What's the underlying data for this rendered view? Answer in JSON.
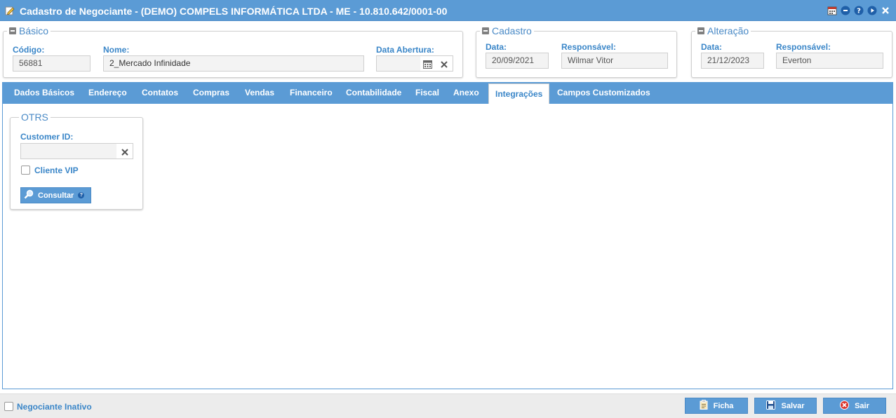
{
  "window": {
    "title": "Cadastro de Negociante - (DEMO) COMPELS INFORMÁTICA LTDA - ME - 10.810.642/0001-00",
    "icons": [
      "calendar-icon",
      "minimize-icon",
      "help-icon",
      "play-icon",
      "close-icon"
    ]
  },
  "basico": {
    "legend": "Básico",
    "codigo_label": "Código:",
    "codigo_value": "56881",
    "nome_label": "Nome:",
    "nome_value": "2_Mercado Infinidade",
    "data_abertura_label": "Data Abertura:",
    "data_abertura_value": ""
  },
  "cadastro": {
    "legend": "Cadastro",
    "data_label": "Data:",
    "data_value": "20/09/2021",
    "responsavel_label": "Responsável:",
    "responsavel_value": "Wilmar Vitor"
  },
  "alteracao": {
    "legend": "Alteração",
    "data_label": "Data:",
    "data_value": "21/12/2023",
    "responsavel_label": "Responsável:",
    "responsavel_value": "Everton"
  },
  "tabs": [
    {
      "label": "Dados Básicos"
    },
    {
      "label": "Endereço"
    },
    {
      "label": "Contatos"
    },
    {
      "label": "Compras"
    },
    {
      "label": "Vendas"
    },
    {
      "label": "Financeiro"
    },
    {
      "label": "Contabilidade"
    },
    {
      "label": "Fiscal"
    },
    {
      "label": "Anexo"
    },
    {
      "label": "Integrações"
    },
    {
      "label": "Campos Customizados"
    }
  ],
  "active_tab": "Integrações",
  "otrs": {
    "legend": "OTRS",
    "customer_id_label": "Customer ID:",
    "customer_id_value": "",
    "cliente_vip_label": "Cliente VIP",
    "consultar_label": "Consultar",
    "help_glyph": "?"
  },
  "footer": {
    "inativo_label": "Negociante Inativo",
    "ficha_label": "Ficha",
    "salvar_label": "Salvar",
    "sair_label": "Sair"
  },
  "colors": {
    "accent": "#5b9bd5",
    "label": "#3a86c8"
  }
}
